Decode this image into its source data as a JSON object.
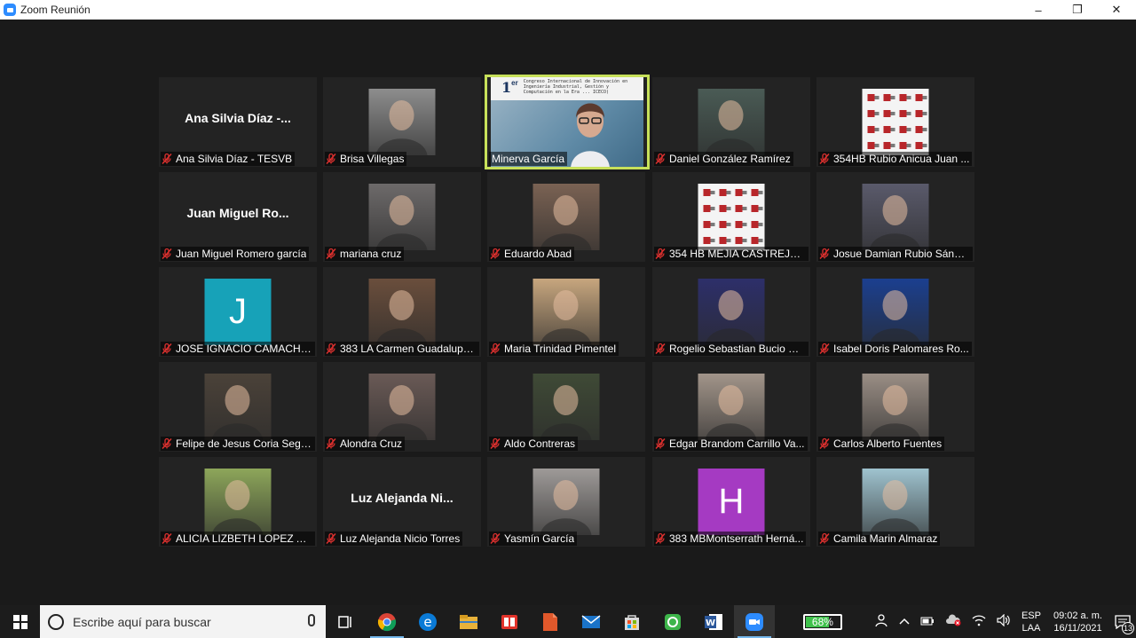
{
  "window": {
    "title": "Zoom Reunión",
    "minimize": "–",
    "restore": "❐",
    "close": "✕"
  },
  "tiles": [
    {
      "label": "Ana Silvia Díaz - TESVB",
      "namecard": "Ana Silvia Díaz -...",
      "muted": true,
      "kind": "name"
    },
    {
      "label": "Brisa Villegas",
      "muted": true,
      "kind": "photo",
      "color": "#8d8d8d"
    },
    {
      "label": "Minerva García",
      "muted": false,
      "kind": "video",
      "active": true,
      "slide_num": "1",
      "slide_sup": "er",
      "slide_text": "Congreso Internacional de Innovación en Ingeniería Industrial, Gestión y Computación en la Era ... ICECO)"
    },
    {
      "label": "Daniel González Ramírez",
      "muted": true,
      "kind": "photo",
      "color": "#4a5b55"
    },
    {
      "label": "354HB Rubio Anicua Juan ...",
      "muted": true,
      "kind": "pattern"
    },
    {
      "label": "Juan Miguel Romero garcía",
      "namecard": "Juan Miguel Ro...",
      "muted": true,
      "kind": "name"
    },
    {
      "label": "mariana cruz",
      "muted": true,
      "kind": "photo",
      "color": "#6d6a6a"
    },
    {
      "label": "Eduardo Abad",
      "muted": true,
      "kind": "photo",
      "color": "#7a6253"
    },
    {
      "label": "354 HB MEJIA CASTREJON ...",
      "muted": true,
      "kind": "pattern"
    },
    {
      "label": "Josue Damian Rubio Sánch...",
      "muted": true,
      "kind": "photo",
      "color": "#5a5a6b"
    },
    {
      "label": "JOSE IGNACIO CAMACHO ...",
      "muted": true,
      "kind": "letter",
      "letter": "J",
      "color": "#17a2b8"
    },
    {
      "label": "383 LA Carmen Guadalupe...",
      "muted": true,
      "kind": "photo",
      "color": "#6a4e3c"
    },
    {
      "label": "Maria Trinidad Pimentel",
      "muted": true,
      "kind": "photo",
      "color": "#c7a67e"
    },
    {
      "label": "Rogelio Sebastian Bucio M...",
      "muted": true,
      "kind": "photo",
      "color": "#2d2f6a"
    },
    {
      "label": "Isabel Doris Palomares Ro...",
      "muted": true,
      "kind": "photo",
      "color": "#1b3f8f"
    },
    {
      "label": "Felipe de Jesus Coria Segu...",
      "muted": true,
      "kind": "photo",
      "color": "#4b4239"
    },
    {
      "label": "Alondra Cruz",
      "muted": true,
      "kind": "photo",
      "color": "#6a5a56"
    },
    {
      "label": "Aldo Contreras",
      "muted": true,
      "kind": "photo",
      "color": "#3f4a36"
    },
    {
      "label": "Edgar Brandom Carrillo Va...",
      "muted": true,
      "kind": "photo",
      "color": "#a2958a"
    },
    {
      "label": "Carlos Alberto Fuentes",
      "muted": true,
      "kind": "photo",
      "color": "#9a8e85"
    },
    {
      "label": "ALICIA LIZBETH LOPEZ AVILA",
      "muted": true,
      "kind": "photo",
      "color": "#8da65a"
    },
    {
      "label": "Luz Alejanda Nicio Torres",
      "namecard": "Luz Alejanda Ni...",
      "muted": true,
      "kind": "name"
    },
    {
      "label": "Yasmín García",
      "muted": true,
      "kind": "photo",
      "color": "#9e9a98"
    },
    {
      "label": "383 MBMontserrath Herná...",
      "muted": true,
      "kind": "letter",
      "letter": "H",
      "color": "#a53ac2"
    },
    {
      "label": "Camila Marin Almaraz",
      "muted": true,
      "kind": "photo",
      "color": "#9fc3cf"
    }
  ],
  "taskbar": {
    "search_placeholder": "Escribe aquí para buscar",
    "battery_percent": "68%",
    "battery_level": 0.68,
    "lang_top": "ESP",
    "lang_bottom": "LAA",
    "time": "09:02 a. m.",
    "date": "16/11/2021",
    "notifications": "13"
  }
}
